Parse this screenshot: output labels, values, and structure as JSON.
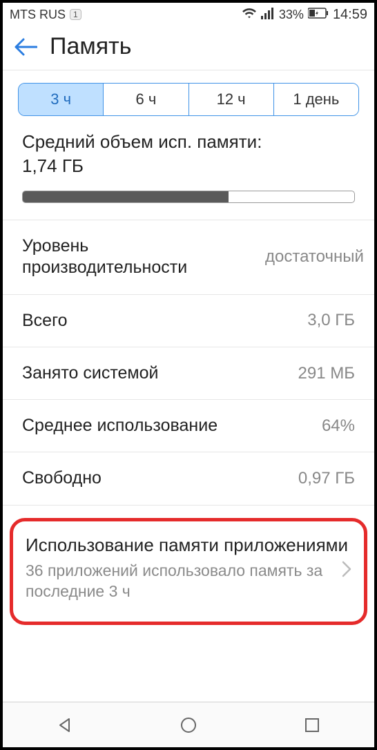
{
  "status": {
    "carrier": "MTS RUS",
    "sim": "1",
    "battery_pct": "33%",
    "time": "14:59"
  },
  "header": {
    "title": "Память"
  },
  "segments": {
    "s0": "3 ч",
    "s1": "6 ч",
    "s2": "12 ч",
    "s3": "1 день"
  },
  "summary": {
    "label": "Средний объем исп. памяти:",
    "value": "1,74 ГБ",
    "fill_pct": 62
  },
  "rows": {
    "perf_label": "Уровень производительности",
    "perf_value": "достаточный",
    "total_label": "Всего",
    "total_value": "3,0 ГБ",
    "system_label": "Занято системой",
    "system_value": "291 МБ",
    "avg_label": "Среднее использование",
    "avg_value": "64%",
    "free_label": "Свободно",
    "free_value": "0,97 ГБ"
  },
  "usage": {
    "title": "Использование памяти приложениями",
    "subtitle": "36 приложений использовало память за последние 3 ч"
  }
}
